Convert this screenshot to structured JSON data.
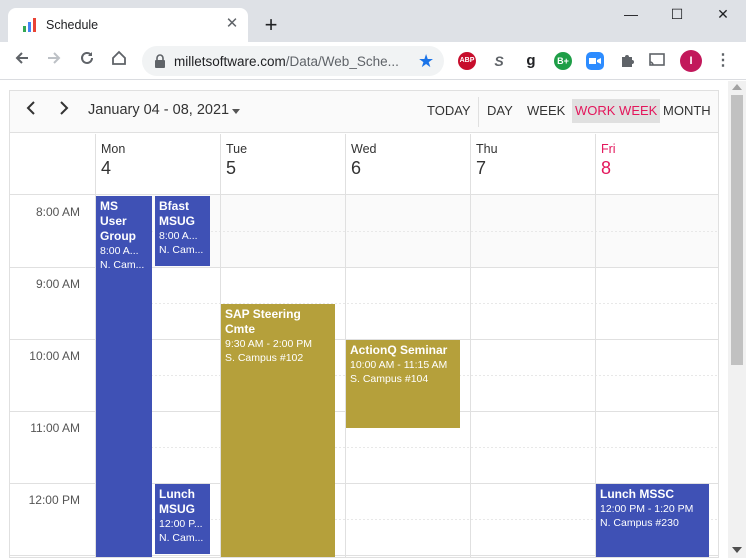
{
  "browser": {
    "tab_title": "Schedule",
    "tab_close": "✕",
    "new_tab": "+",
    "url_host": "milletsoftware.com",
    "url_path": "/Data/Web_Sche...",
    "window_minimize": "—",
    "window_maximize": "☐",
    "window_close": "✕",
    "extensions": [
      {
        "label": "ABP",
        "color": "#c70d2c"
      },
      {
        "label": "S",
        "color": "#ffffff"
      },
      {
        "label": "g",
        "color": "#ffffff"
      },
      {
        "label": "B+",
        "color": "#1e9e47"
      },
      {
        "label": "",
        "color": "#2d8cff"
      },
      {
        "label": "",
        "color": "#ffffff"
      },
      {
        "label": "",
        "color": "#ffffff"
      },
      {
        "label": "I",
        "color": "#c2185b"
      }
    ]
  },
  "calendar": {
    "date_range": "January 04 - 08, 2021",
    "views": {
      "today": "TODAY",
      "day": "DAY",
      "week": "WEEK",
      "work_week": "WORK WEEK",
      "month": "MONTH"
    },
    "days": [
      {
        "name": "Mon",
        "num": "4"
      },
      {
        "name": "Tue",
        "num": "5"
      },
      {
        "name": "Wed",
        "num": "6"
      },
      {
        "name": "Thu",
        "num": "7"
      },
      {
        "name": "Fri",
        "num": "8"
      }
    ],
    "times": [
      "8:00 AM",
      "9:00 AM",
      "10:00 AM",
      "11:00 AM",
      "12:00 PM"
    ],
    "events": [
      {
        "title": "MS User Group",
        "time": "8:00 A...",
        "loc": "N. Cam..."
      },
      {
        "title": "Bfast MSUG",
        "time": "8:00 A...",
        "loc": "N. Cam..."
      },
      {
        "title": "Lunch MSUG",
        "time": "12:00 P...",
        "loc": "N. Cam..."
      },
      {
        "title": "SAP Steering Cmte",
        "time": "9:30 AM - 2:00 PM",
        "loc": "S. Campus #102"
      },
      {
        "title": "ActionQ Seminar",
        "time": "10:00 AM - 11:15 AM",
        "loc": "S. Campus #104"
      },
      {
        "title": "Lunch MSSC",
        "time": "12:00 PM - 1:20 PM",
        "loc": "N. Campus #230"
      }
    ]
  }
}
